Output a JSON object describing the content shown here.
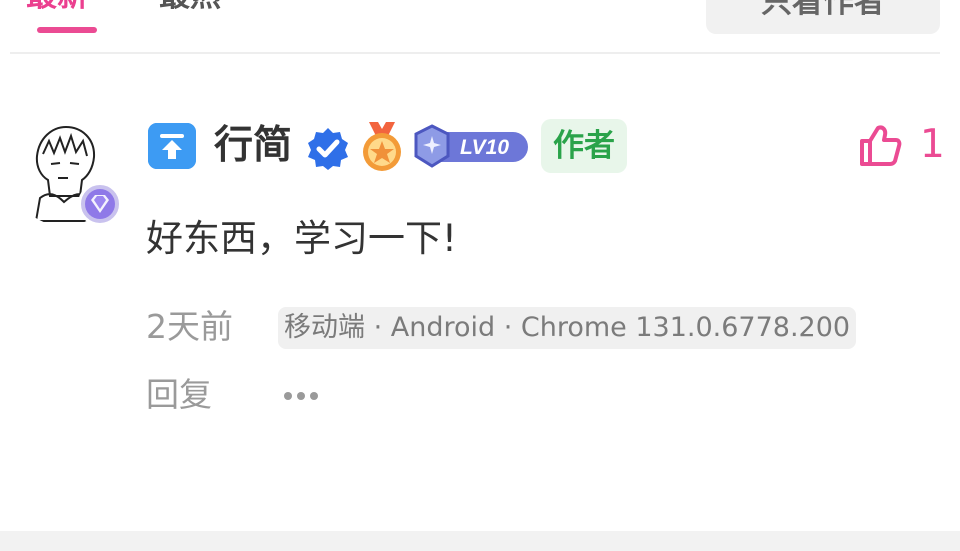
{
  "tabs": {
    "latest": "最新",
    "hot": "最热",
    "author_only": "只看作者"
  },
  "comment": {
    "username": "行简",
    "author_tag": "作者",
    "level": "LV10",
    "like_count": "1",
    "text": "好东西，学习一下!",
    "time": "2天前",
    "device": "移动端 · Android · Chrome 131.0.6778.200",
    "reply": "回复"
  },
  "colors": {
    "accent": "#eb4b93",
    "author_green": "#2aa34a",
    "verified_blue": "#2f6fe8"
  }
}
